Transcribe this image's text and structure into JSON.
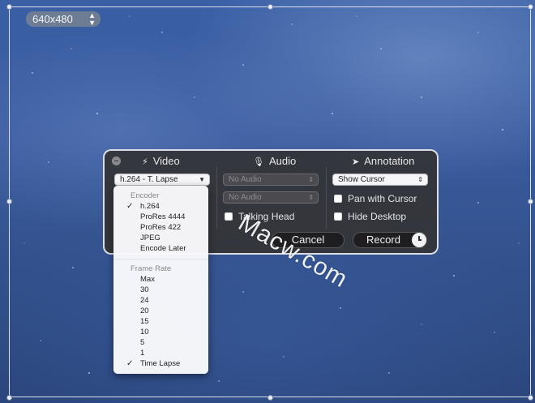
{
  "resolution": {
    "label": "640x480"
  },
  "panel": {
    "video": {
      "title": "Video",
      "encoder_popup": "h.264 - T. Lapse"
    },
    "audio": {
      "title": "Audio",
      "input_popup": "No Audio",
      "second_popup": "No Audio",
      "talking_head_label": "Talking Head"
    },
    "annotation": {
      "title": "Annotation",
      "cursor_popup": "Show Cursor",
      "pan_label": "Pan with Cursor",
      "hide_desktop_label": "Hide Desktop"
    },
    "cancel_label": "Cancel",
    "record_label": "Record"
  },
  "menu": {
    "encoder_header": "Encoder",
    "encoders": [
      "h.264",
      "ProRes 4444",
      "ProRes 422",
      "JPEG",
      "Encode Later"
    ],
    "frame_rate_header": "Frame Rate",
    "frame_rates": [
      "Max",
      "30",
      "24",
      "20",
      "15",
      "10",
      "5",
      "1",
      "Time Lapse"
    ]
  },
  "watermark": "Macw.com",
  "colors": {
    "panel_bg": "#343436",
    "menu_bg": "#fafafc",
    "sky": "#3a5a9e"
  },
  "icons": [
    "video-lightning-icon",
    "microphone-icon",
    "cursor-arrow-icon",
    "clock-icon",
    "close-icon"
  ]
}
